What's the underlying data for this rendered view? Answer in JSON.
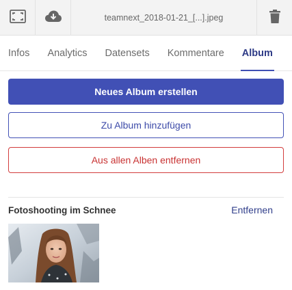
{
  "toolbar": {
    "filename": "teamnext_2018-01-21_[...].jpeg",
    "fit_icon": "fit-to-screen-icon",
    "download_icon": "cloud-download-icon",
    "delete_icon": "trash-icon"
  },
  "tabs": [
    {
      "label": "Infos",
      "active": false
    },
    {
      "label": "Analytics",
      "active": false
    },
    {
      "label": "Datensets",
      "active": false
    },
    {
      "label": "Kommentare",
      "active": false
    },
    {
      "label": "Album",
      "active": true
    }
  ],
  "actions": {
    "create_album": "Neues Album erstellen",
    "add_to_album": "Zu Album hinzufügen",
    "remove_from_all": "Aus allen Alben entfernen"
  },
  "albums": [
    {
      "name": "Fotoshooting im Schnee",
      "remove_label": "Entfernen"
    }
  ],
  "colors": {
    "primary": "#4150b5",
    "danger": "#d23b3b",
    "toolbar_bg": "#f3f3f3"
  }
}
